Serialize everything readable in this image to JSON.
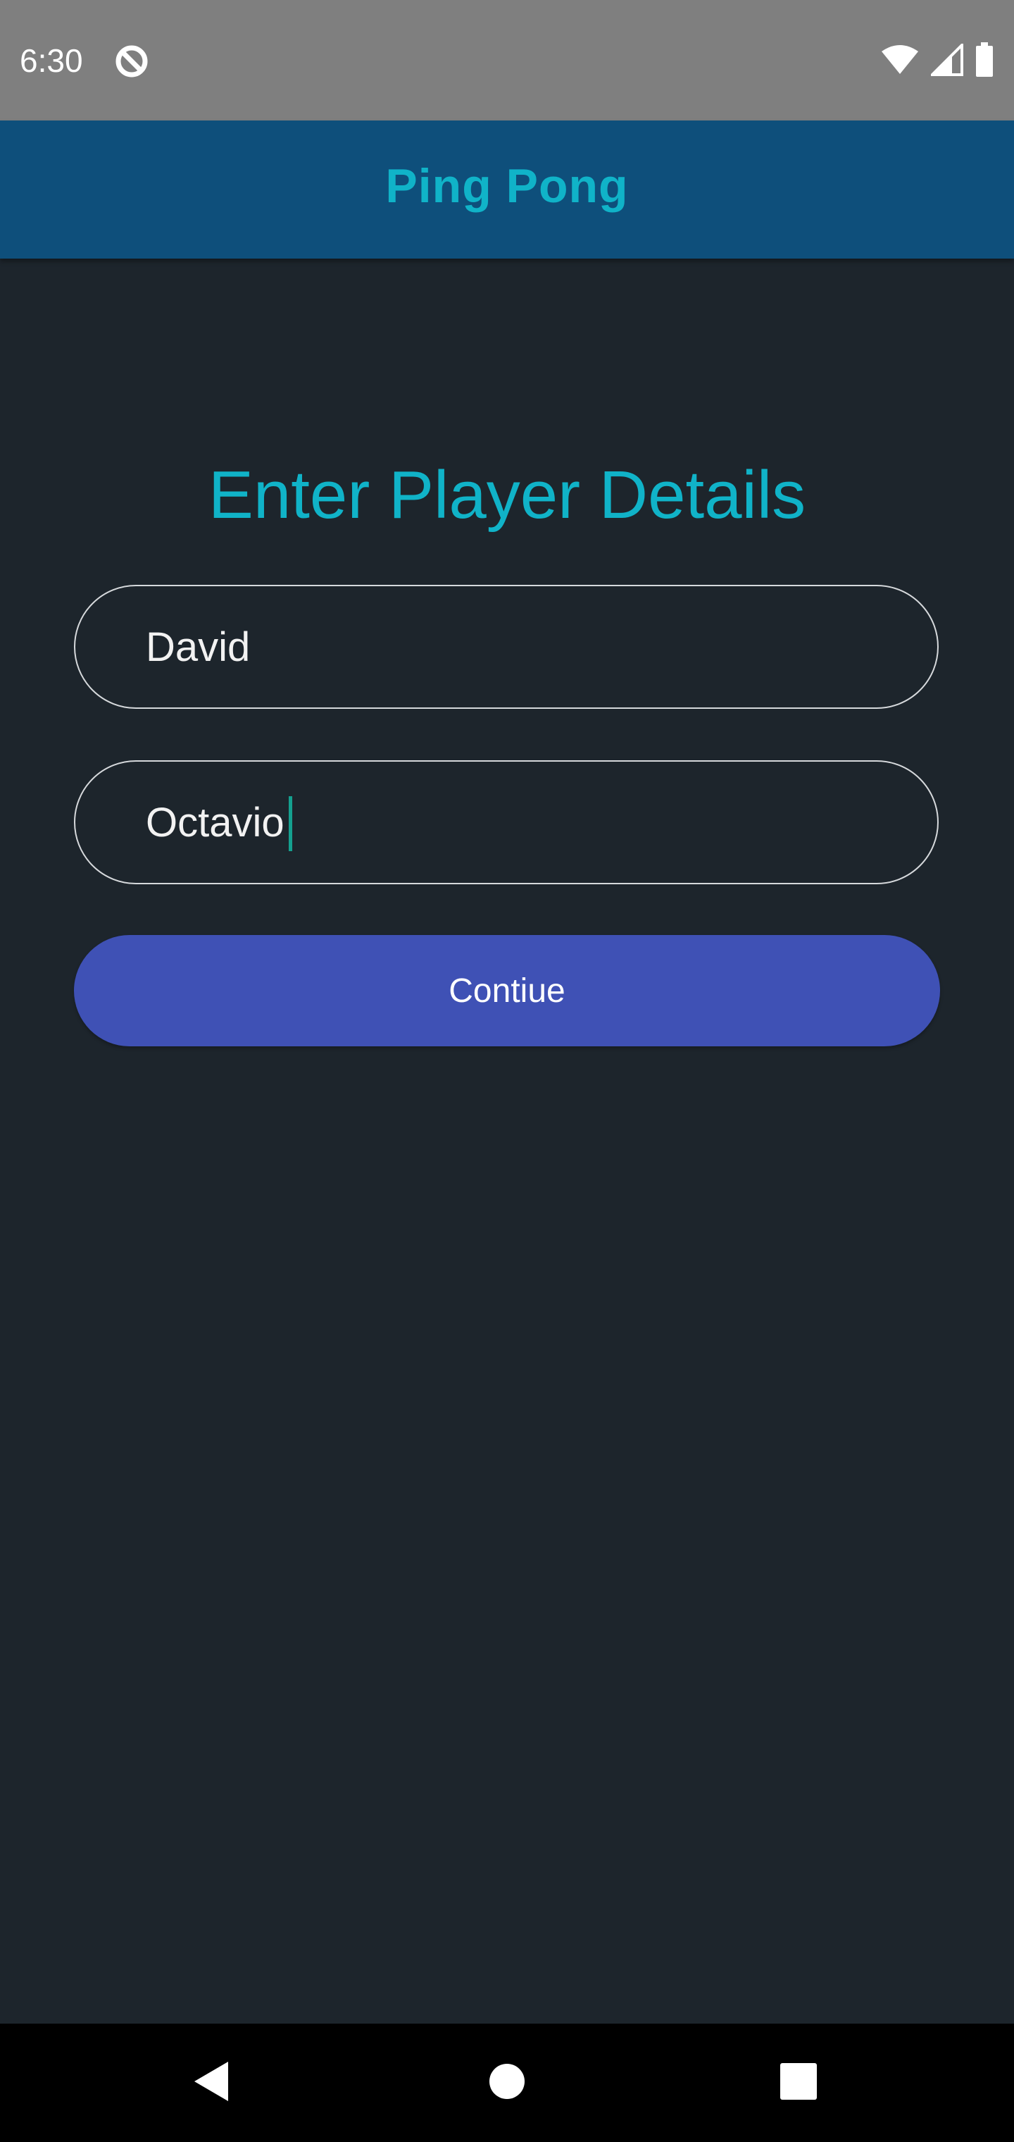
{
  "status_bar": {
    "time": "6:30",
    "app_icon": "app-notification-icon",
    "wifi_icon": "wifi-icon",
    "signal_icon": "cell-signal-icon",
    "battery_icon": "battery-icon"
  },
  "app_bar": {
    "title": "Ping Pong"
  },
  "form": {
    "heading": "Enter Player Details",
    "player1": {
      "value": "David"
    },
    "player2": {
      "value": "Octavio"
    },
    "continue_label": "Contiue"
  },
  "nav_bar": {
    "back_icon": "back-triangle-icon",
    "home_icon": "home-circle-icon",
    "recents_icon": "recents-square-icon"
  },
  "colors": {
    "background": "#1d252c",
    "status_bar": "#7f7f7f",
    "app_bar": "#0e4f7b",
    "accent_teal": "#10b3c8",
    "button": "#3f51b5",
    "caret": "#14a08f"
  }
}
